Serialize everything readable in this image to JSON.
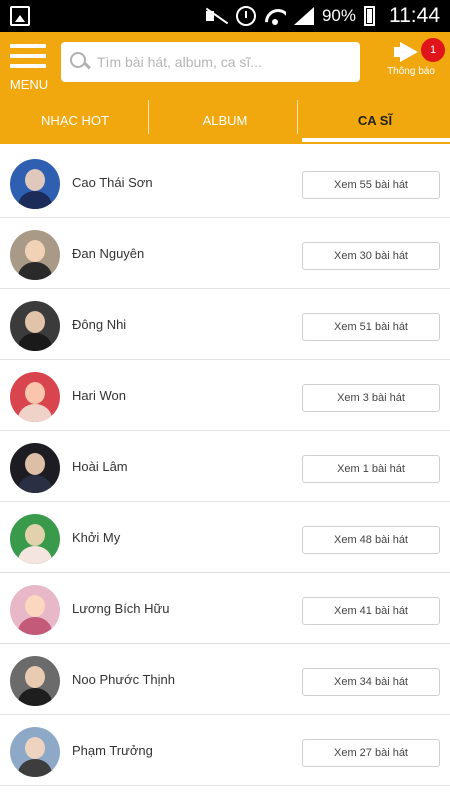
{
  "status_bar": {
    "battery": "90%",
    "time": "11:44"
  },
  "header": {
    "menu_label": "MENU",
    "search_placeholder": "Tìm bài hát, album, ca sĩ...",
    "notification_label": "Thông báo",
    "notification_count": "1"
  },
  "tabs": [
    {
      "label": "NHẠC HOT",
      "active": false
    },
    {
      "label": "ALBUM",
      "active": false
    },
    {
      "label": "CA SĨ",
      "active": true
    }
  ],
  "colors": {
    "brand": "#f1a80f",
    "badge": "#e0141b"
  },
  "singers": [
    {
      "name": "Cao Thái Sơn",
      "button": "Xem 55 bài hát",
      "bg": "#2f5fb0",
      "shirt": "#1c2c5a"
    },
    {
      "name": "Đan Nguyên",
      "button": "Xem 30 bài hát",
      "bg": "#a89a86",
      "shirt": "#2a2a2a"
    },
    {
      "name": "Đông Nhi",
      "button": "Xem 51 bài hát",
      "bg": "#3b3b3b",
      "shirt": "#1a1a1a"
    },
    {
      "name": "Hari Won",
      "button": "Xem 3 bài hát",
      "bg": "#d8454e",
      "shirt": "#f0d3c8"
    },
    {
      "name": "Hoài Lâm",
      "button": "Xem 1 bài hát",
      "bg": "#1c1c22",
      "shirt": "#2b2f44"
    },
    {
      "name": "Khởi My",
      "button": "Xem 48 bài hát",
      "bg": "#3a9a4c",
      "shirt": "#f4e5e0"
    },
    {
      "name": "Lương Bích Hữu",
      "button": "Xem 41 bài hát",
      "bg": "#e8b8c8",
      "shirt": "#c45a7a"
    },
    {
      "name": "Noo Phước Thịnh",
      "button": "Xem 34 bài hát",
      "bg": "#6b6b6b",
      "shirt": "#1e1e1e"
    },
    {
      "name": "Phạm Trưởng",
      "button": "Xem 27 bài hát",
      "bg": "#8ea9c8",
      "shirt": "#3d3d3d"
    }
  ]
}
